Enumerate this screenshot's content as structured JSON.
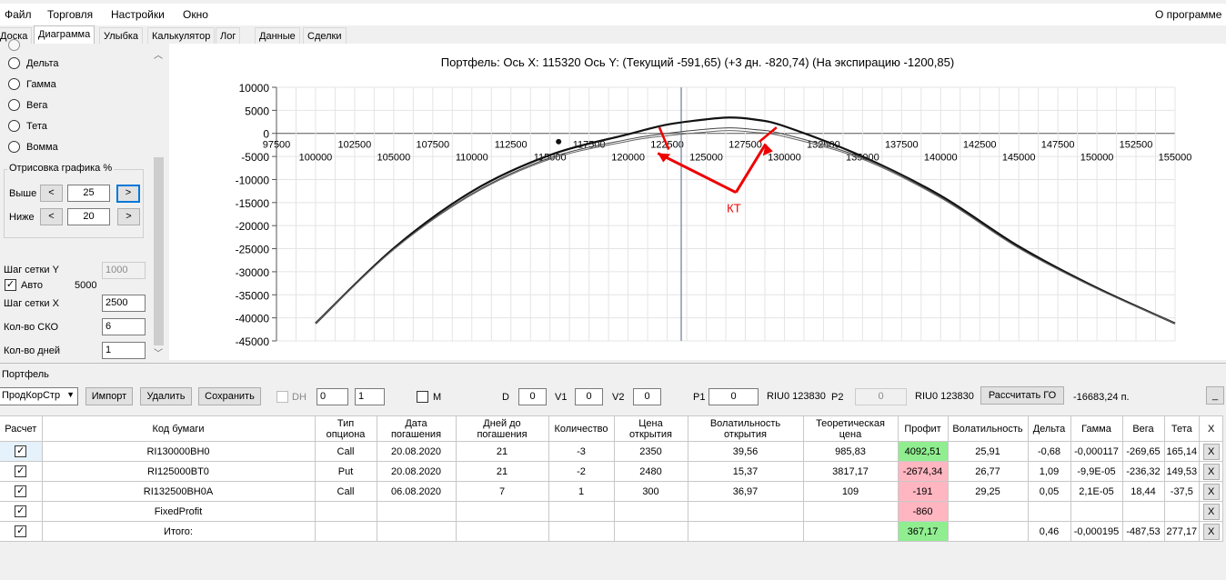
{
  "menu": {
    "file": "Файл",
    "trading": "Торговля",
    "settings": "Настройки",
    "window": "Окно",
    "about": "О программе"
  },
  "tabs": [
    "Доска",
    "Диаграмма",
    "Улыбка",
    "Калькулятор",
    "Лог",
    "Данные",
    "Сделки"
  ],
  "left": {
    "radios": [
      "Дельта",
      "Гамма",
      "Вега",
      "Тета",
      "Вомма"
    ],
    "group_title": "Отрисовка графика %",
    "above_label": "Выше",
    "below_label": "Ниже",
    "above_value": "25",
    "below_value": "20",
    "prev_btn": "<",
    "next_btn": ">",
    "grid_y_label": "Шаг сетки Y",
    "grid_y_value": "1000",
    "auto_label": "Авто",
    "auto_checked": "✓",
    "auto_value": "5000",
    "grid_x_label": "Шаг сетки X",
    "grid_x_value": "2500",
    "sko_label": "Кол-во СКО",
    "sko_value": "6",
    "days_label": "Кол-во дней",
    "days_value": "1"
  },
  "chart_data": {
    "type": "line",
    "title": "Портфель: Ось X: 115320 Ось Y:  (Текущий -591,65)  (+3 дн. -820,74)  (На экспирацию -1200,85)",
    "xlim": [
      97500,
      155000
    ],
    "ylim": [
      -45000,
      10000
    ],
    "y_ticks": [
      "10000",
      "5000",
      "0",
      "-5000",
      "-10000",
      "-15000",
      "-20000",
      "-25000",
      "-30000",
      "-35000",
      "-40000",
      "-45000"
    ],
    "x_ticks_upper": [
      "97500",
      "102500",
      "107500",
      "112500",
      "117500",
      "122500",
      "127500",
      "132500",
      "137500",
      "142500",
      "147500",
      "152500"
    ],
    "x_ticks_lower": [
      "100000",
      "105000",
      "110000",
      "115000",
      "120000",
      "125000",
      "130000",
      "135000",
      "140000",
      "145000",
      "150000",
      "155000"
    ],
    "grid": true,
    "cursor_x": 123400,
    "marker": {
      "x": 115320,
      "y": -1200
    },
    "annotation": "КТ",
    "series": [
      {
        "x": [
          100000,
          105000,
          110000,
          115000,
          120000,
          122500,
          125000,
          126500,
          128000,
          130000,
          135000,
          140000,
          145000,
          150000,
          155000
        ],
        "y": [
          -41200,
          -24900,
          -12600,
          -4700,
          -190,
          1900,
          3050,
          3450,
          3050,
          1550,
          -5000,
          -13500,
          -24500,
          -33500,
          -41200
        ]
      },
      {
        "x": [
          100000,
          105000,
          110000,
          115000,
          120000,
          122500,
          125000,
          126500,
          128000,
          130000,
          135000,
          140000,
          145000,
          150000,
          155000
        ],
        "y": [
          -41200,
          -25100,
          -13100,
          -5300,
          -1300,
          0,
          900,
          1200,
          850,
          -200,
          -5300,
          -13800,
          -24800,
          -33600,
          -41200
        ]
      },
      {
        "x": [
          100000,
          105000,
          110000,
          115000,
          120000,
          122500,
          125000,
          126500,
          128000,
          130000,
          135000,
          140000,
          145000,
          150000,
          155000
        ],
        "y": [
          -41200,
          -25200,
          -13300,
          -5600,
          -1700,
          -500,
          300,
          600,
          250,
          -700,
          -5600,
          -14000,
          -24900,
          -33700,
          -41200
        ]
      }
    ]
  },
  "toolbar": {
    "section": "Портфель",
    "portfolio": "ПродКорСтр",
    "import": "Импорт",
    "delete": "Удалить",
    "save": "Сохранить",
    "dh": "DH",
    "spin1": "0",
    "spin2": "1",
    "m": "M",
    "d_label": "D",
    "d_val": "0",
    "v1_label": "V1",
    "v1_val": "0",
    "v2_label": "V2",
    "v2_val": "0",
    "p1_label": "P1",
    "p1_val": "0",
    "riu1": "RIU0 123830",
    "p2_label": "P2",
    "p2_val": "0",
    "riu2": "RIU0 123830",
    "calc_go": "Рассчитать ГО",
    "go_value": "-16683,24 п.",
    "minimize": "_"
  },
  "grid": {
    "headers": [
      "Расчет",
      "Код бумаги",
      "Тип опциона",
      "Дата погашения",
      "Дней до погашения",
      "Количество",
      "Цена открытия",
      "Волатильность открытия",
      "Теоретическая цена",
      "Профит",
      "Волатильность",
      "Дельта",
      "Гамма",
      "Вега",
      "Тета",
      "X"
    ],
    "check": "✓",
    "xbtn": "X",
    "rows": [
      {
        "code": "RI130000BH0",
        "type": "Call",
        "date": "20.08.2020",
        "days": "21",
        "qty": "-3",
        "price": "2350",
        "vol_open": "39,56",
        "theor": "985,83",
        "profit": "4092,51",
        "vol": "25,91",
        "delta": "-0,68",
        "gamma": "-0,000117",
        "vega": "-269,65",
        "theta": "165,14"
      },
      {
        "code": "RI125000BT0",
        "type": "Put",
        "date": "20.08.2020",
        "days": "21",
        "qty": "-2",
        "price": "2480",
        "vol_open": "15,37",
        "theor": "3817,17",
        "profit": "-2674,34",
        "vol": "26,77",
        "delta": "1,09",
        "gamma": "-9,9E-05",
        "vega": "-236,32",
        "theta": "149,53"
      },
      {
        "code": "RI132500BH0A",
        "type": "Call",
        "date": "06.08.2020",
        "days": "7",
        "qty": "1",
        "price": "300",
        "vol_open": "36,97",
        "theor": "109",
        "profit": "-191",
        "vol": "29,25",
        "delta": "0,05",
        "gamma": "2,1E-05",
        "vega": "18,44",
        "theta": "-37,5"
      },
      {
        "code": "FixedProfit",
        "type": "",
        "date": "",
        "days": "",
        "qty": "",
        "price": "",
        "vol_open": "",
        "theor": "",
        "profit": "-860",
        "vol": "",
        "delta": "",
        "gamma": "",
        "vega": "",
        "theta": ""
      },
      {
        "code": "Итого:",
        "type": "",
        "date": "",
        "days": "",
        "qty": "",
        "price": "",
        "vol_open": "",
        "theor": "",
        "profit": "367,17",
        "vol": "",
        "delta": "0,46",
        "gamma": "-0,000195",
        "vega": "-487,53",
        "theta": "277,17"
      }
    ]
  }
}
